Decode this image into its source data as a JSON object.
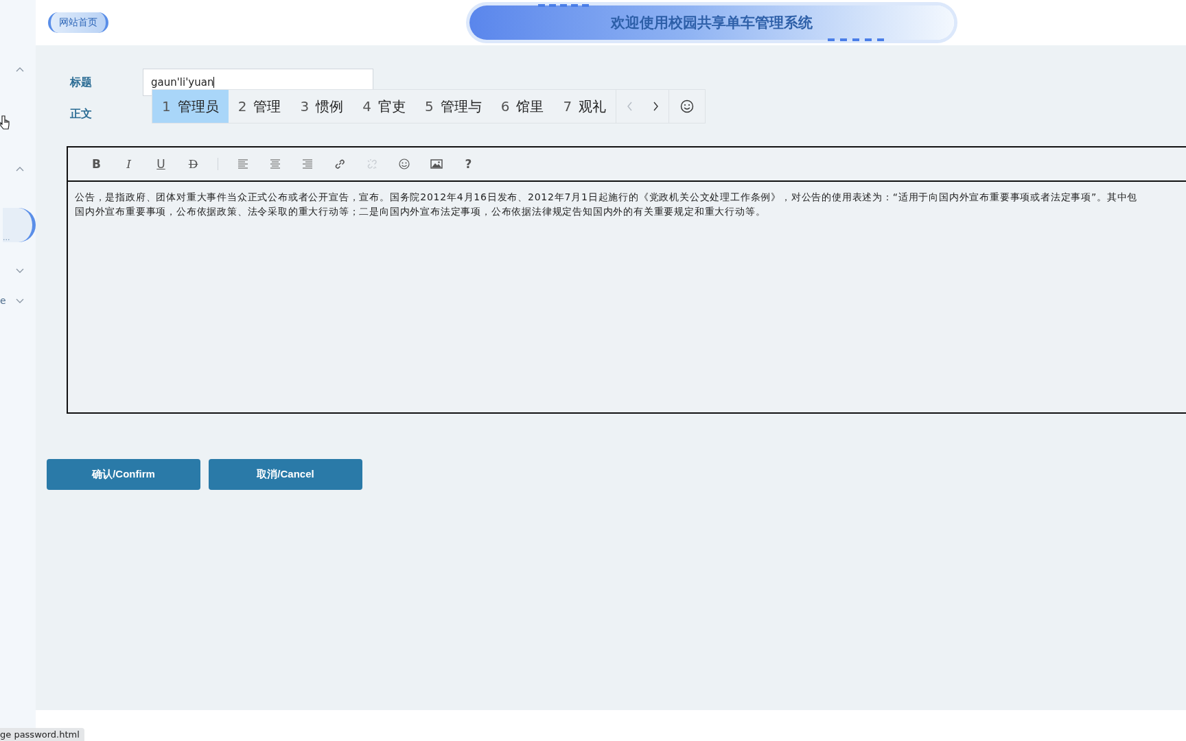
{
  "header": {
    "home_link": "网站首页",
    "title": "欢迎使用校园共享单车管理系统"
  },
  "sidebar": {
    "items": [
      {
        "kind": "toggle",
        "expanded": true
      },
      {
        "kind": "toggle",
        "expanded": true
      },
      {
        "kind": "entry",
        "label": "...",
        "selected": true
      },
      {
        "kind": "toggle",
        "expanded": false
      },
      {
        "kind": "toggle",
        "label": "e",
        "expanded": false
      }
    ]
  },
  "form": {
    "title_label": "标题",
    "title_value": "gaun'li'yuan",
    "body_label": "正文"
  },
  "ime": {
    "candidates": [
      {
        "number": "1",
        "text": "管理员",
        "selected": true
      },
      {
        "number": "2",
        "text": "管理",
        "selected": false
      },
      {
        "number": "3",
        "text": "惯例",
        "selected": false
      },
      {
        "number": "4",
        "text": "官吏",
        "selected": false
      },
      {
        "number": "5",
        "text": "管理与",
        "selected": false
      },
      {
        "number": "6",
        "text": "馆里",
        "selected": false
      },
      {
        "number": "7",
        "text": "观礼",
        "selected": false
      }
    ],
    "nav": [
      {
        "kind": "prev",
        "disabled": true
      },
      {
        "kind": "next",
        "disabled": false
      }
    ]
  },
  "editor": {
    "toolbar": [
      {
        "kind": "bold",
        "label": "B",
        "disabled": false
      },
      {
        "kind": "italic",
        "label": "I",
        "disabled": false
      },
      {
        "kind": "underline",
        "label": "U",
        "disabled": false
      },
      {
        "kind": "strike",
        "label": "D",
        "disabled": false
      },
      {
        "kind": "separator"
      },
      {
        "kind": "align-left",
        "disabled": false
      },
      {
        "kind": "align-center",
        "disabled": false
      },
      {
        "kind": "align-right",
        "disabled": false
      },
      {
        "kind": "link",
        "disabled": false
      },
      {
        "kind": "unlink",
        "disabled": true
      },
      {
        "kind": "emoji",
        "disabled": false
      },
      {
        "kind": "image",
        "disabled": false
      },
      {
        "kind": "help",
        "label": "?",
        "disabled": false
      }
    ],
    "lines": [
      "公告，是指政府、团体对重大事件当众正式公布或者公开宣告，宣布。国务院2012年4月16日发布、2012年7月1日起施行的《党政机关公文处理工作条例》，对公告的使用表述为：“适用于向国内外宣布重要事项或者法定事项”。其中包",
      "国内外宣布重要事项，公布依据政策、法令采取的重大行动等；二是向国内外宣布法定事项，公布依据法律规定告知国内外的有关重要规定和重大行动等。"
    ]
  },
  "buttons": [
    "确认/Confirm",
    "取消/Cancel"
  ],
  "status_url": "ge password.html"
}
